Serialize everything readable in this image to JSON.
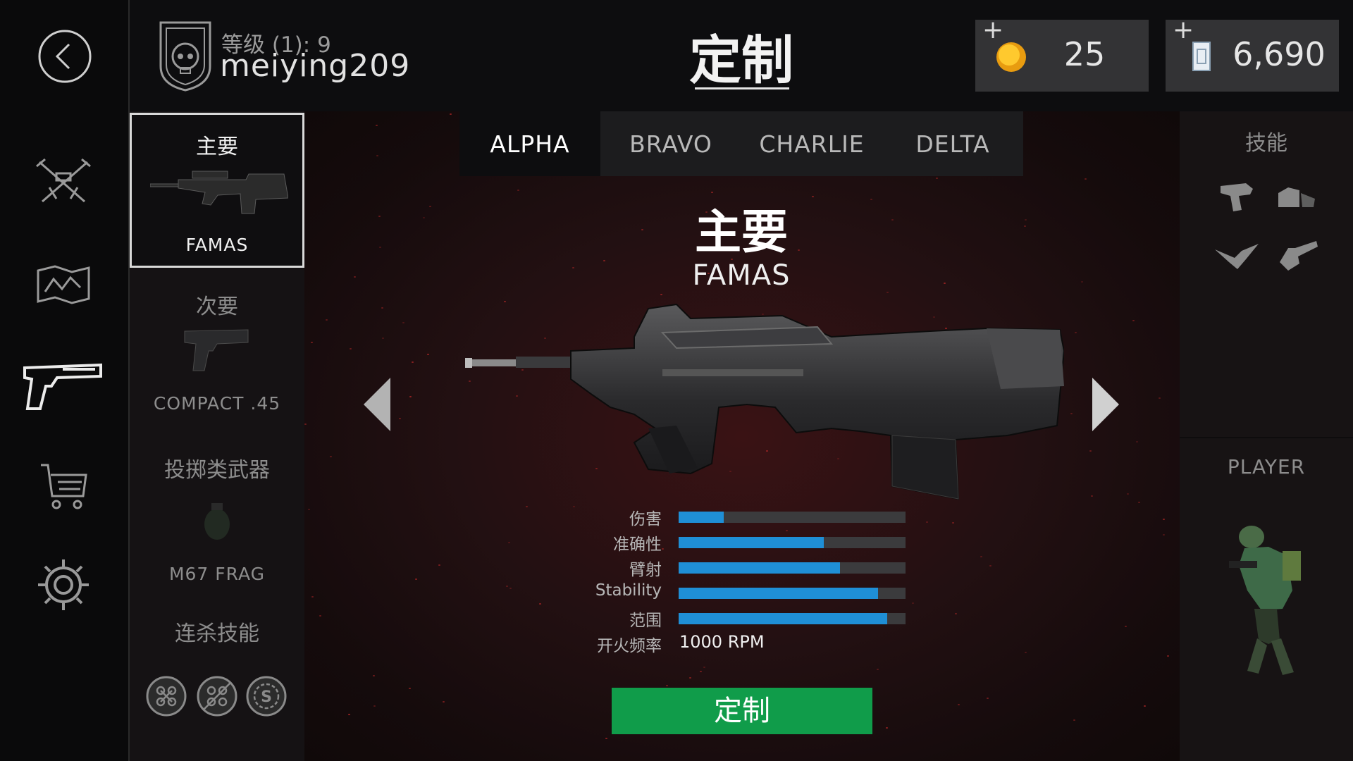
{
  "nav": {
    "back": "back-icon",
    "items": [
      {
        "icon": "crossed-rifles-icon"
      },
      {
        "icon": "map-icon"
      },
      {
        "icon": "pistol-icon",
        "active": true
      },
      {
        "icon": "shopping-cart-icon"
      },
      {
        "icon": "gear-icon"
      }
    ]
  },
  "profile": {
    "rank_text": "等级 (1): 9",
    "username": "meiying209"
  },
  "page_title": "定制",
  "currency": {
    "coins": {
      "plus": "+",
      "value": "25",
      "icon": "gold-coin-icon"
    },
    "cash": {
      "plus": "+",
      "value": "6,690",
      "icon": "cash-stack-icon"
    }
  },
  "slots": {
    "primary": {
      "label": "主要",
      "name": "FAMAS"
    },
    "secondary": {
      "label": "次要",
      "name": "COMPACT .45"
    },
    "throwable": {
      "label": "投掷类武器",
      "name": "M67 FRAG"
    },
    "killstreak": {
      "label": "连杀技能",
      "icons": [
        "drone-icon",
        "drone-disabled-icon",
        "airstrike-icon"
      ]
    }
  },
  "tabs": [
    "ALPHA",
    "BRAVO",
    "CHARLIE",
    "DELTA"
  ],
  "active_tab": "ALPHA",
  "weapon": {
    "category": "主要",
    "name": "FAMAS"
  },
  "stats": [
    {
      "label": "伤害",
      "value": 0.2
    },
    {
      "label": "准确性",
      "value": 0.64
    },
    {
      "label": "臂射",
      "value": 0.71
    },
    {
      "label": "Stability",
      "value": 0.88
    },
    {
      "label": "范围",
      "value": 0.92
    }
  ],
  "fire_rate": {
    "label": "开火频率",
    "value": "1000 RPM"
  },
  "customize_button": "定制",
  "right_panel": {
    "skills_title": "技能",
    "skill_icons": [
      "rifle-skill-icon",
      "sniper-skill-icon",
      "eagle-skill-icon",
      "grenade-skill-icon"
    ],
    "player_title": "PLAYER"
  },
  "colors": {
    "accent": "#1f8fd6",
    "button": "#109c4a",
    "background": "#0c0c0e"
  }
}
